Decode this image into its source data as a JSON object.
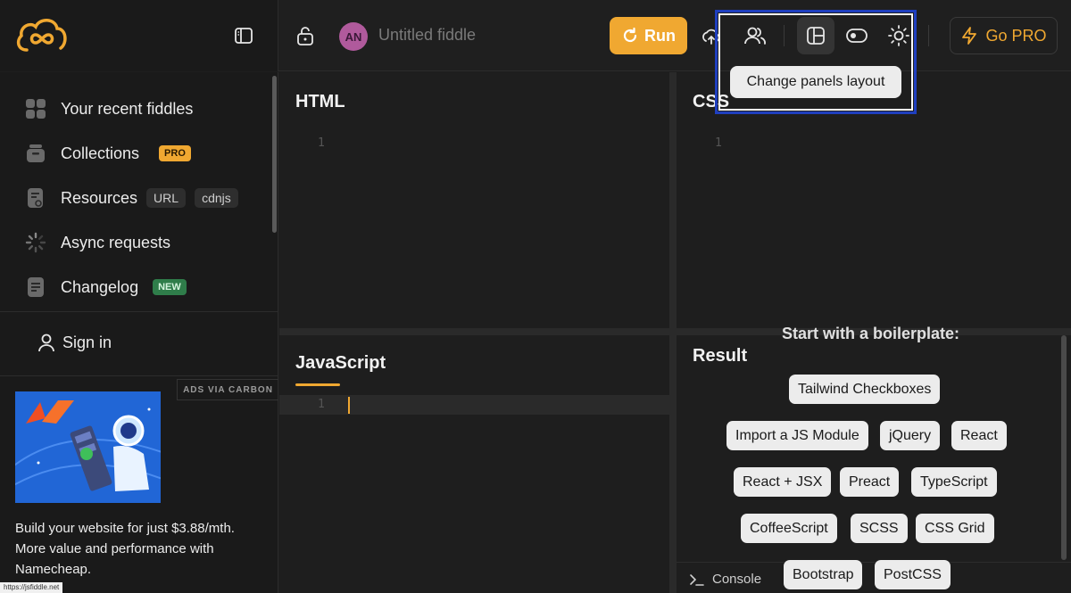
{
  "header": {
    "fiddle_title": "Untitled fiddle",
    "avatar_initials": "AN",
    "run_label": "Run",
    "gopro_label": "Go PRO",
    "tooltip": "Change panels layout"
  },
  "sidebar": {
    "items": [
      {
        "label": "Your recent fiddles",
        "icon": "grid-icon"
      },
      {
        "label": "Collections",
        "icon": "box-icon",
        "badge": "PRO"
      },
      {
        "label": "Resources",
        "icon": "file-icon",
        "tags": [
          "URL",
          "cdnjs"
        ]
      },
      {
        "label": "Async requests",
        "icon": "spinner-icon"
      },
      {
        "label": "Changelog",
        "icon": "doc-icon",
        "badge": "NEW"
      }
    ],
    "signin_label": "Sign in",
    "ads_label": "ADS VIA CARBON",
    "ad_text": "Build your website for just $3.88/mth. More value and performance with Namecheap.",
    "status_url": "https://jsfiddle.net"
  },
  "panels": {
    "html": {
      "title": "HTML",
      "line": "1"
    },
    "css": {
      "title": "CSS",
      "line": "1"
    },
    "js": {
      "title": "JavaScript",
      "line": "1"
    },
    "result": {
      "title": "Result",
      "boilerplate_heading": "Start with a boilerplate:",
      "chips": [
        "Tailwind Checkboxes",
        "Import a JS Module",
        "jQuery",
        "React",
        "React + JSX",
        "Preact",
        "TypeScript",
        "CoffeeScript",
        "SCSS",
        "CSS Grid",
        "Bootstrap",
        "PostCSS"
      ],
      "console_label": "Console"
    }
  },
  "colors": {
    "accent": "#f0a831",
    "background": "#1e1e1e",
    "highlight_box": "#1f3fbf"
  }
}
